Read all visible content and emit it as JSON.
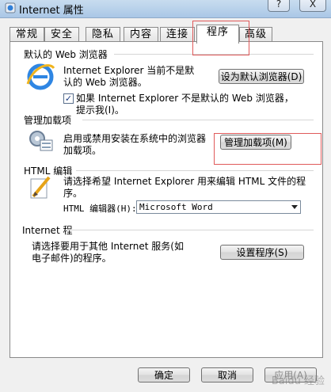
{
  "window": {
    "title": "Internet 属性",
    "title_buttons": [
      "?",
      "X"
    ]
  },
  "tabs": [
    {
      "label": "常规"
    },
    {
      "label": "安全"
    },
    {
      "label": "隐私"
    },
    {
      "label": "内容"
    },
    {
      "label": "连接"
    },
    {
      "label": "程序"
    },
    {
      "label": "高级"
    }
  ],
  "default_browser": {
    "group": "默认的 Web 浏览器",
    "status": "Internet Explorer 当前不是默认的 Web 浏览器。",
    "button": "设为默认浏览器(D)",
    "checkbox_checked": true,
    "checkbox_label": "如果 Internet Explorer 不是默认的 Web 浏览器，提示我(I)。"
  },
  "addons": {
    "group": "管理加载项",
    "description": "启用或禁用安装在系统中的浏览器加载项。",
    "button": "管理加载项(M)"
  },
  "html_editing": {
    "group": "HTML 编辑",
    "description": "请选择希望 Internet Explorer 用来编辑 HTML 文件的程序。",
    "editor_label": "HTML 编辑器(H):",
    "editor_value": "Microsoft Word"
  },
  "internet_programs": {
    "group": "Internet 程",
    "description": "请选择要用于其他 Internet 服务(如电子邮件)的程序。",
    "button": "设置程序(S)"
  },
  "footer": {
    "ok": "确定",
    "cancel": "取消",
    "apply": "应用(A)"
  },
  "watermark": "Baidu 经验"
}
